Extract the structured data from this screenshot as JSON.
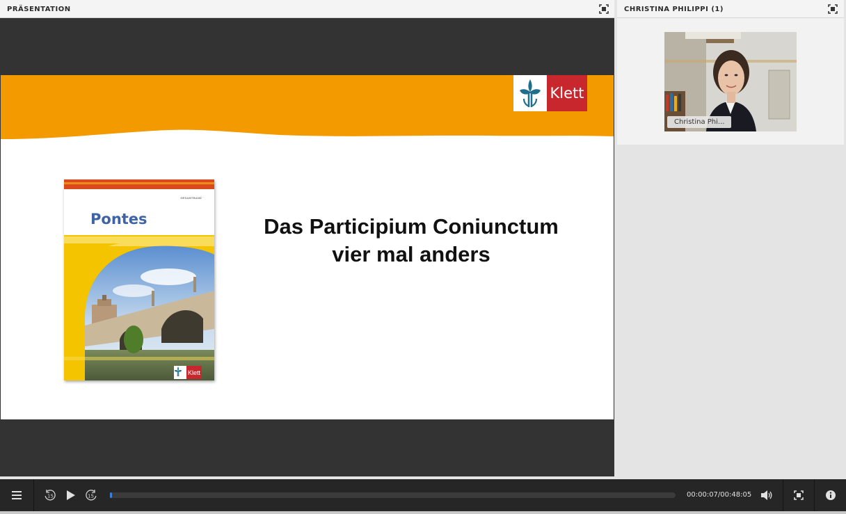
{
  "presentation_pod": {
    "title": "PRÄSENTATION",
    "fullscreen_icon": "fullscreen-icon"
  },
  "slide": {
    "heading_line1": "Das Participium Coniunctum",
    "heading_line2": "vier mal anders",
    "logo_text": "Klett",
    "banner_color": "#f39a00",
    "book": {
      "title": "Pontes",
      "edition": "GESAMTBAND",
      "logo_text": "Klett"
    }
  },
  "camera_pod": {
    "title": "CHRISTINA PHILIPPI (1)",
    "name_tag": "Christina Phi..."
  },
  "controls": {
    "menu_icon": "menu-icon",
    "rewind_icon": "rewind-15-icon",
    "play_icon": "play-icon",
    "forward_icon": "forward-15-icon",
    "skip_seconds": "15",
    "time_display": "00:00:07/00:48:05",
    "progress_percent": 0.24,
    "volume_icon": "volume-icon",
    "fullscreen_icon": "fullscreen-icon",
    "info_icon": "info-icon",
    "accent_color": "#3b7fd8"
  }
}
